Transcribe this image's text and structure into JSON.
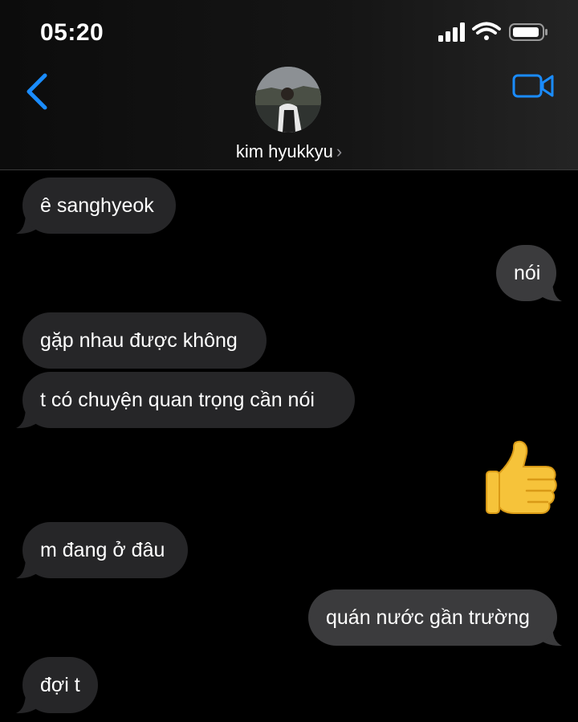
{
  "status_bar": {
    "time": "05:20"
  },
  "header": {
    "contact_name": "kim hyukkyu",
    "chevron": "›"
  },
  "messages": [
    {
      "text": "ê sanghyeok",
      "from": "them"
    },
    {
      "text": "nói",
      "from": "me"
    },
    {
      "text": "gặp nhau được không",
      "from": "them"
    },
    {
      "text": "t có chuyện quan trọng cần nói",
      "from": "them"
    },
    {
      "text": "👍",
      "from": "me",
      "type": "emoji"
    },
    {
      "text": "m đang ở đâu",
      "from": "them"
    },
    {
      "text": "quán nước gần trường",
      "from": "me"
    },
    {
      "text": "đợi t",
      "from": "them"
    }
  ],
  "icons": [
    "back-chevron-icon",
    "video-call-icon",
    "signal-icon",
    "wifi-icon",
    "battery-icon"
  ],
  "colors": {
    "accent": "#1a8cff",
    "incoming_bubble": "#262628",
    "outgoing_bubble": "#3b3b3d"
  }
}
